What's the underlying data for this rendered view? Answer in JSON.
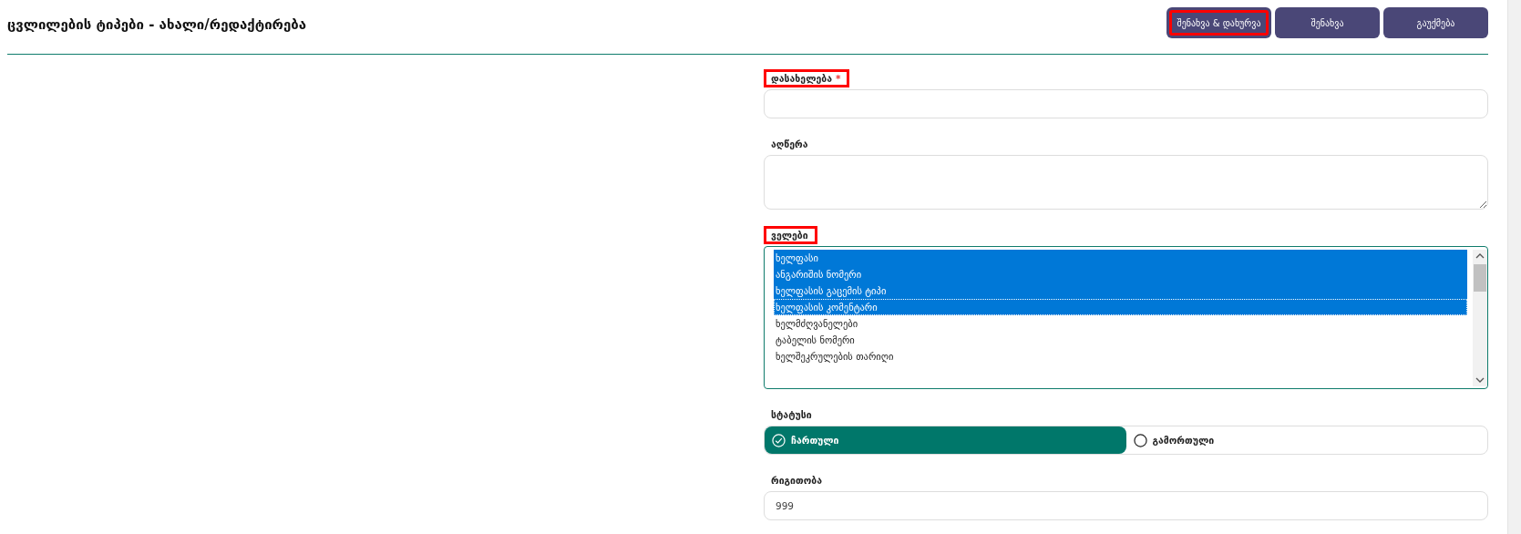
{
  "header": {
    "title": "ცვლილების ტიპები - ახალი/რედაქტირება",
    "buttons": [
      {
        "label": "შენახვა & დახურვა",
        "highlighted": true
      },
      {
        "label": "შენახვა",
        "highlighted": false
      },
      {
        "label": "გაუქმება",
        "highlighted": false
      }
    ]
  },
  "form": {
    "name": {
      "label": "დასახელება",
      "required_mark": "*",
      "highlighted": true
    },
    "description": {
      "label": "აღწერა",
      "highlighted": false
    },
    "fields": {
      "label": "ველები",
      "highlighted": true,
      "items": [
        {
          "label": "ხელფასი",
          "selected": true,
          "focused": false
        },
        {
          "label": "ანგარიშის ნომერი",
          "selected": true,
          "focused": false
        },
        {
          "label": "ხელფასის გაცემის ტიპი",
          "selected": true,
          "focused": false
        },
        {
          "label": "ხელფასის კომენტარი",
          "selected": true,
          "focused": true
        },
        {
          "label": "ხელმძღვანელები",
          "selected": false,
          "focused": false
        },
        {
          "label": "ტაბელის ნომერი",
          "selected": false,
          "focused": false
        },
        {
          "label": "ხელშეკრულების თარიღი",
          "selected": false,
          "focused": false
        }
      ]
    },
    "status": {
      "label": "სტატუსი",
      "options": [
        {
          "label": "ჩართული",
          "selected": true
        },
        {
          "label": "გამორთული",
          "selected": false
        }
      ]
    },
    "order": {
      "label": "რიგითობა",
      "value": "999"
    }
  }
}
